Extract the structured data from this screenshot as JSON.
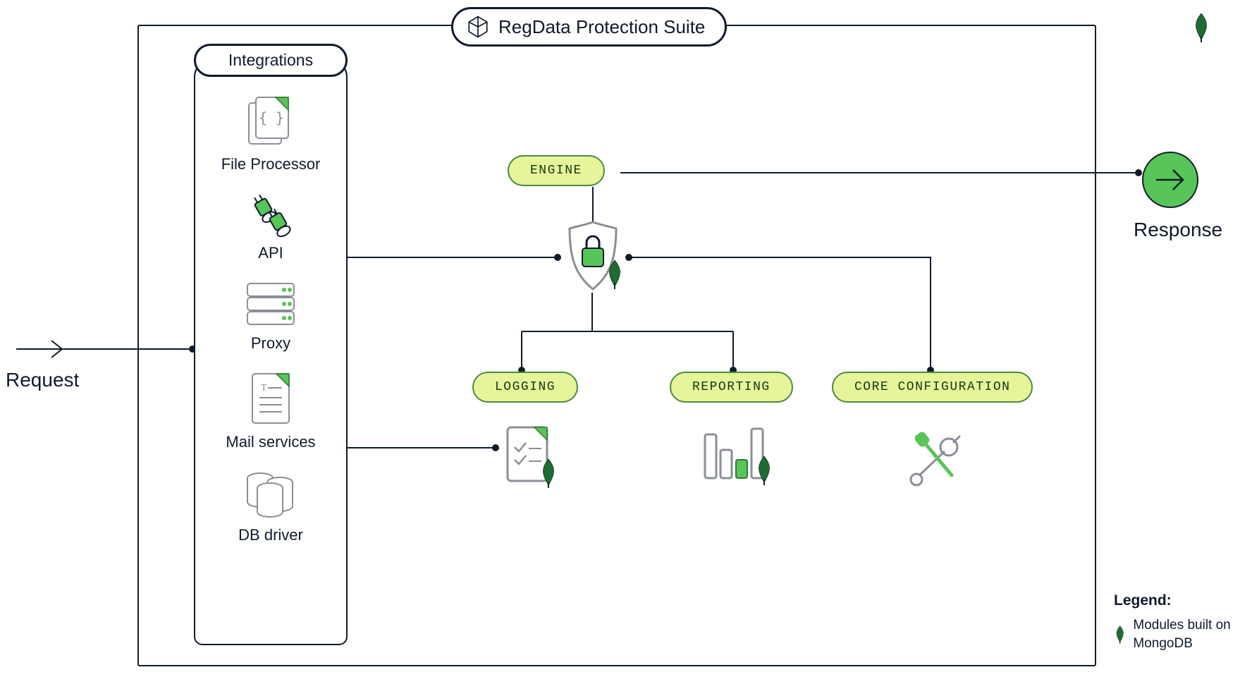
{
  "diagram": {
    "suite_title": "RegData Protection Suite",
    "request_label": "Request",
    "response_label": "Response",
    "integrations": {
      "header": "Integrations",
      "items": [
        {
          "label": "File Processor"
        },
        {
          "label": "API"
        },
        {
          "label": "Proxy"
        },
        {
          "label": "Mail services"
        },
        {
          "label": "DB driver"
        }
      ]
    },
    "modules": {
      "engine": "ENGINE",
      "logging": "LOGGING",
      "reporting": "REPORTING",
      "core_config": "CORE CONFIGURATION"
    },
    "legend": {
      "title": "Legend:",
      "leaf_text": "Modules built on MongoDB"
    },
    "connectors": [
      {
        "from": "Request",
        "to": "Integrations"
      },
      {
        "from": "Integrations",
        "to": "Engine(shield)"
      },
      {
        "from": "Integrations",
        "to": "Logging"
      },
      {
        "from": "Engine",
        "to": "Response"
      },
      {
        "from": "Engine(shield)",
        "to": "Logging"
      },
      {
        "from": "Engine(shield)",
        "to": "Reporting"
      },
      {
        "from": "Engine(shield)",
        "to": "Core Configuration"
      },
      {
        "from": "Core Configuration",
        "to": "Engine(shield)"
      }
    ],
    "mongodb_modules": [
      "Engine",
      "Logging",
      "Reporting"
    ]
  }
}
